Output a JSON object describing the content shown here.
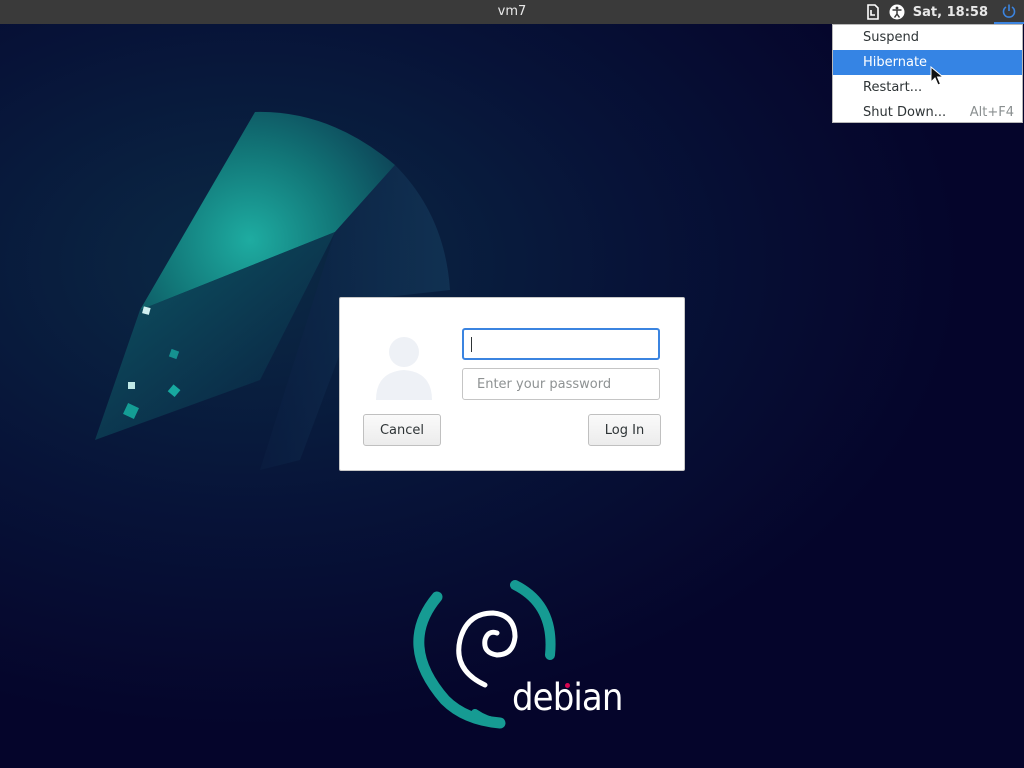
{
  "topbar": {
    "hostname": "vm7",
    "clock": "Sat, 18:58",
    "icons": [
      "keyboard-layout-icon",
      "accessibility-icon",
      "power-icon"
    ]
  },
  "power_menu": {
    "items": [
      {
        "label": "Suspend",
        "accel": ""
      },
      {
        "label": "Hibernate",
        "accel": ""
      },
      {
        "label": "Restart...",
        "accel": ""
      },
      {
        "label": "Shut Down...",
        "accel": "Alt+F4"
      }
    ],
    "highlighted_index": 1
  },
  "login": {
    "username_value": "",
    "password_placeholder": "Enter your password",
    "cancel_label": "Cancel",
    "login_label": "Log In"
  },
  "branding": {
    "logo_text": "debian"
  },
  "colors": {
    "accent": "#3584e4",
    "topbar": "#3a3a3a",
    "background": "#05052b",
    "teal": "#1a9f98",
    "debian_red": "#d70751"
  }
}
